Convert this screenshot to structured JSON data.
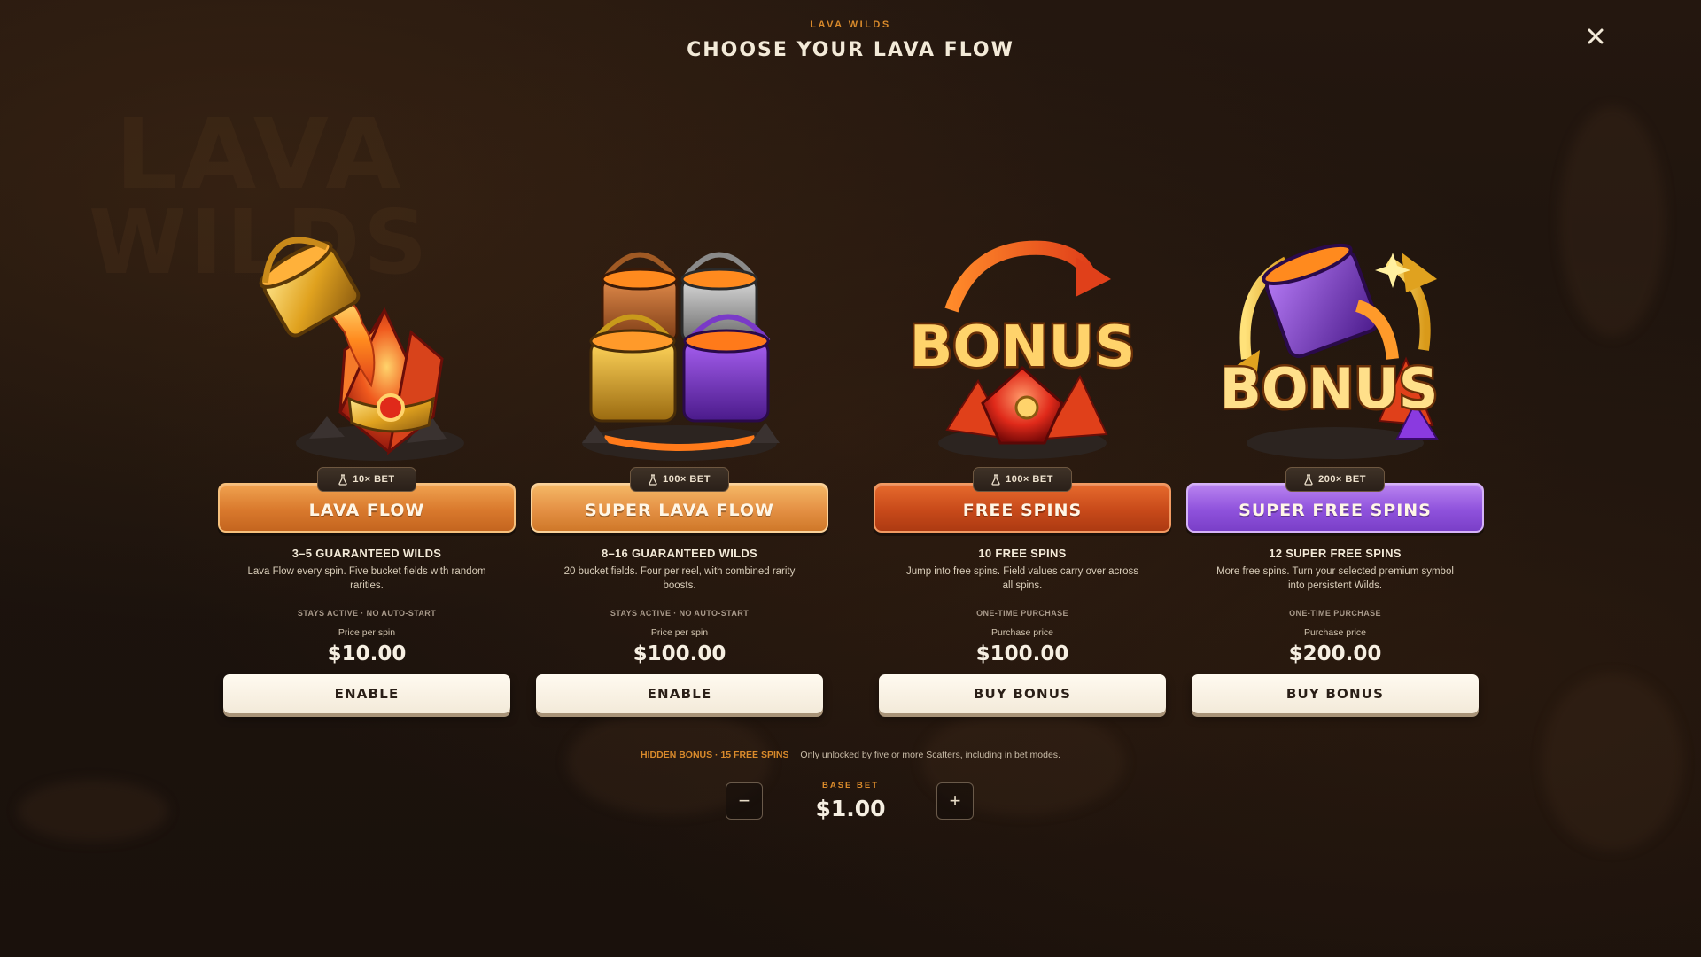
{
  "header": {
    "subtitle": "LAVA WILDS",
    "title": "CHOOSE YOUR LAVA FLOW",
    "close_icon": "close-icon"
  },
  "background": {
    "logo_line_1": "LAVA",
    "logo_line_2": "WILDS"
  },
  "cards": [
    {
      "art_icon": "lava-bucket-crystals-art",
      "badge": "10× BET",
      "title": "LAVA FLOW",
      "banner_color": "#d9792d",
      "headline": "3–5 GUARANTEED WILDS",
      "description": "Lava Flow every spin. Five bucket fields with random rarities.",
      "status": "STAYS ACTIVE · NO AUTO-START",
      "price_label": "Price per spin",
      "price": "$10.00",
      "action": "ENABLE"
    },
    {
      "art_icon": "four-lava-buckets-art",
      "badge": "100× BET",
      "title": "SUPER LAVA FLOW",
      "banner_color": "#e49044",
      "headline": "8–16 GUARANTEED WILDS",
      "description": "20 bucket fields. Four per reel, with combined rarity boosts.",
      "status": "STAYS ACTIVE · NO AUTO-START",
      "price_label": "Price per spin",
      "price": "$100.00",
      "action": "ENABLE"
    },
    {
      "art_icon": "bonus-gem-art",
      "badge": "100× BET",
      "title": "FREE SPINS",
      "banner_color": "#c84a1a",
      "headline": "10 FREE SPINS",
      "description": "Jump into free spins. Field values carry over across all spins.",
      "status": "ONE-TIME PURCHASE",
      "price_label": "Purchase price",
      "price": "$100.00",
      "action": "BUY BONUS"
    },
    {
      "art_icon": "super-bonus-bucket-art",
      "badge": "200× BET",
      "title": "SUPER FREE SPINS",
      "banner_color": "#8f52dc",
      "headline": "12 SUPER FREE SPINS",
      "description": "More free spins. Turn your selected premium symbol into persistent Wilds.",
      "status": "ONE-TIME PURCHASE",
      "price_label": "Purchase price",
      "price": "$200.00",
      "action": "BUY BONUS"
    }
  ],
  "footer": {
    "hidden_bonus_label": "HIDDEN BONUS · 15 FREE SPINS",
    "hidden_bonus_text": "Only unlocked by five or more Scatters, including in bet modes.",
    "base_bet_label": "BASE BET",
    "base_bet_value": "$1.00",
    "minus_label": "−",
    "plus_label": "+"
  },
  "colors": {
    "accent": "#d98a2b",
    "text_primary": "#f3ead8",
    "button_bg": "#fffaf0"
  }
}
